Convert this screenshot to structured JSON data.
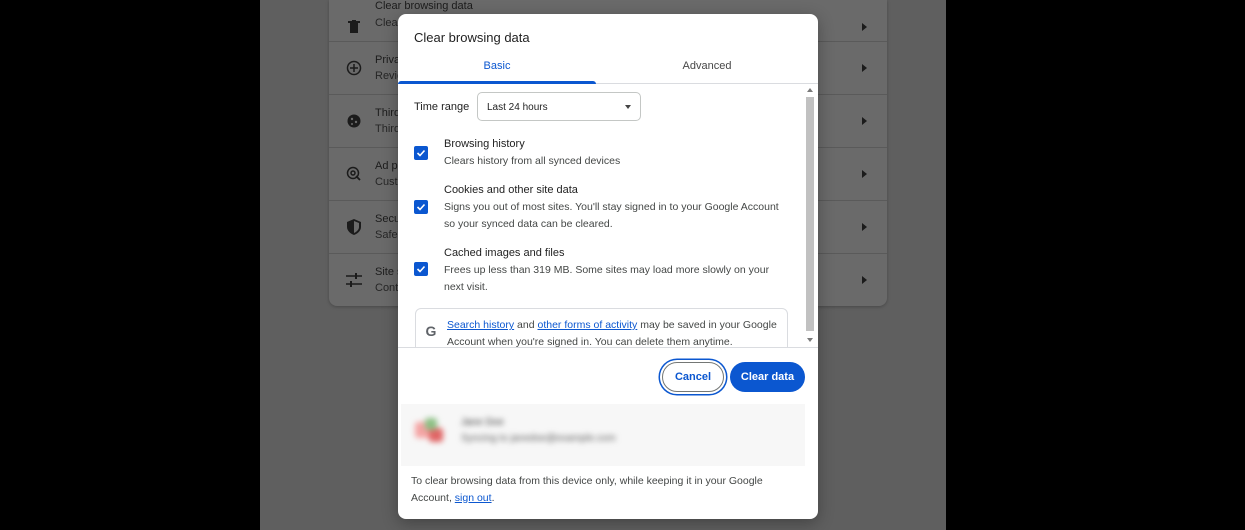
{
  "background_settings": {
    "rows": [
      {
        "title": "Clear browsing data",
        "sub": "Clear",
        "icon": "trash-icon"
      },
      {
        "title": "Priva",
        "sub": "Revie",
        "icon": "compass-icon"
      },
      {
        "title": "Third",
        "sub": "Third",
        "icon": "cookie-icon"
      },
      {
        "title": "Ad p",
        "sub": "Custo",
        "icon": "ad-privacy-icon"
      },
      {
        "title": "Secu",
        "sub": "Safe",
        "icon": "shield-icon"
      },
      {
        "title": "Site s",
        "sub": "Cont",
        "icon": "sliders-icon"
      }
    ]
  },
  "dialog": {
    "title": "Clear browsing data",
    "tabs": {
      "basic": "Basic",
      "advanced": "Advanced"
    },
    "time_range": {
      "label": "Time range",
      "value": "Last 24 hours"
    },
    "options": [
      {
        "title": "Browsing history",
        "desc": "Clears history from all synced devices",
        "checked": true
      },
      {
        "title": "Cookies and other site data",
        "desc": "Signs you out of most sites. You'll stay signed in to your Google Account so your synced data can be cleared.",
        "checked": true
      },
      {
        "title": "Cached images and files",
        "desc": "Frees up less than 319 MB. Some sites may load more slowly on your next visit.",
        "checked": true
      }
    ],
    "google_notice": {
      "icon": "google-g-icon",
      "link1": "Search history",
      "and": "and",
      "link2": "other forms of activity",
      "rest": "may be saved in your Google Account when you're signed in. You can delete them anytime."
    },
    "buttons": {
      "cancel": "Cancel",
      "clear": "Clear data"
    },
    "account": {
      "name": "Jane Doe",
      "email": "Syncing to janedoe@example.com"
    },
    "footer": {
      "text": "To clear browsing data from this device only, while keeping it in your Google Account,",
      "link": "sign out",
      "end": "."
    }
  },
  "colors": {
    "accent": "#0b57d0",
    "backdrop": "#5f5f5f",
    "dialog_bg": "#ffffff"
  }
}
